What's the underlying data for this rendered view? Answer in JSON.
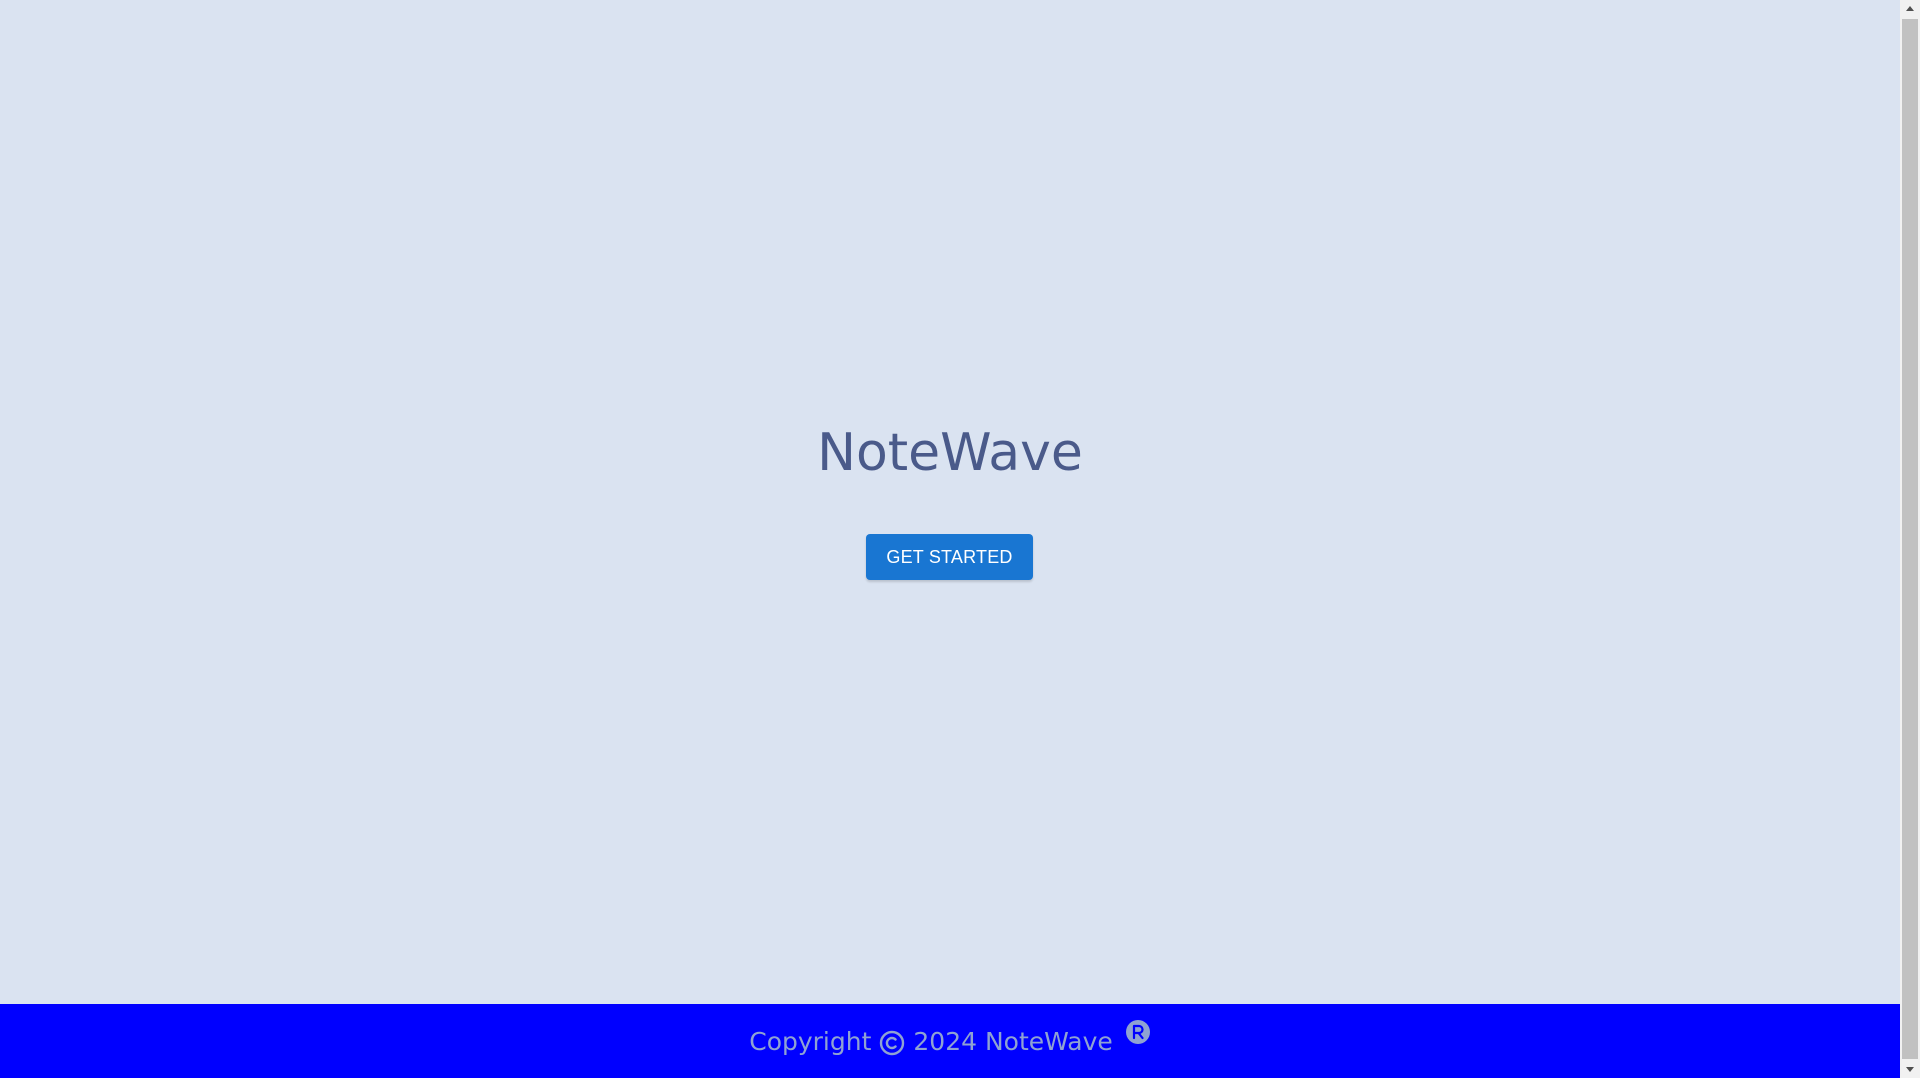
{
  "hero": {
    "title": "NoteWave",
    "cta_label": "GET STARTED"
  },
  "footer": {
    "copyright_prefix": "Copyright",
    "copyright_year_brand": "2024 NoteWave",
    "copyright_icon": "copyright-icon",
    "registered_icon": "registered-icon"
  },
  "colors": {
    "page_background": "#dae3f1",
    "title_text": "#4a5a8a",
    "button_background": "#1976d2",
    "button_text": "#ffffff",
    "footer_background": "#0000ff",
    "footer_text": "#8fa2d2"
  }
}
